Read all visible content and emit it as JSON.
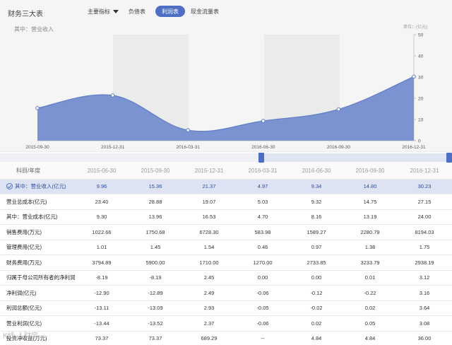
{
  "header": {
    "title": "财务三大表",
    "nav": {
      "main_indicator": "主要指标",
      "balance_sheet": "负债表",
      "income_statement": "利润表",
      "cash_flow": "现金流量表"
    }
  },
  "chart": {
    "series_label": "其中：营业收入",
    "unit_label": "单位：(亿元)"
  },
  "chart_data": {
    "type": "area",
    "x": [
      "2015-09-30",
      "2015-12-31",
      "2016-03-31",
      "2016-06-30",
      "2016-09-30",
      "2016-12-31"
    ],
    "series": [
      {
        "name": "其中：营业收入",
        "values": [
          15.36,
          21.37,
          4.97,
          9.34,
          14.8,
          30.23
        ]
      }
    ],
    "ylim": [
      0,
      50
    ],
    "yticks": [
      0,
      10,
      20,
      30,
      40,
      50
    ],
    "grid": true,
    "colors": {
      "fill": "#7b93d0",
      "line": "#5f7cc6"
    }
  },
  "table": {
    "header_label": "科目/年度",
    "columns": [
      "2015-06-30",
      "2015-09-30",
      "2015-12-31",
      "2016-03-31",
      "2016-06-30",
      "2016-09-30",
      "2016-12-31"
    ],
    "rows": [
      {
        "label": "其中：营业收入(亿元)",
        "values": [
          "9.96",
          "15.36",
          "21.37",
          "4.97",
          "9.34",
          "14.80",
          "30.23"
        ]
      },
      {
        "label": "营业总成本(亿元)",
        "values": [
          "23.40",
          "28.88",
          "19.07",
          "5.03",
          "9.32",
          "14.75",
          "27.15"
        ]
      },
      {
        "label": "其中：营业成本(亿元)",
        "values": [
          "9.30",
          "13.96",
          "16.53",
          "4.70",
          "8.16",
          "13.19",
          "24.00"
        ]
      },
      {
        "label": "销售费用(万元)",
        "values": [
          "1022.66",
          "1750.68",
          "6728.30",
          "583.98",
          "1589.27",
          "2280.79",
          "8194.03"
        ]
      },
      {
        "label": "管理费用(亿元)",
        "values": [
          "1.01",
          "1.45",
          "1.54",
          "0.46",
          "0.97",
          "1.38",
          "1.75"
        ]
      },
      {
        "label": "财务费用(万元)",
        "values": [
          "3794.89",
          "5900.00",
          "1710.00",
          "1270.00",
          "2733.85",
          "3233.79",
          "2938.19"
        ]
      },
      {
        "label": "归属于母公司所有者的净利润",
        "values": [
          "-8.19",
          "-8.19",
          "2.45",
          "0.00",
          "0.00",
          "0.01",
          "3.12"
        ]
      },
      {
        "label": "净利润(亿元)",
        "values": [
          "-12.90",
          "-12.89",
          "2.49",
          "-0.06",
          "-0.12",
          "-0.22",
          "3.16"
        ]
      },
      {
        "label": "利润总额(亿元)",
        "values": [
          "-13.11",
          "-13.09",
          "2.93",
          "-0.05",
          "-0.02",
          "0.02",
          "3.64"
        ]
      },
      {
        "label": "营业利润(亿元)",
        "values": [
          "-13.44",
          "-13.52",
          "2.37",
          "-0.06",
          "0.02",
          "0.05",
          "3.08"
        ]
      },
      {
        "label": "投资净收益(万元)",
        "values": [
          "73.37",
          "73.37",
          "689.29",
          "--",
          "4.84",
          "4.84",
          "36.00"
        ]
      }
    ]
  },
  "watermark": "K线·人财宝..."
}
